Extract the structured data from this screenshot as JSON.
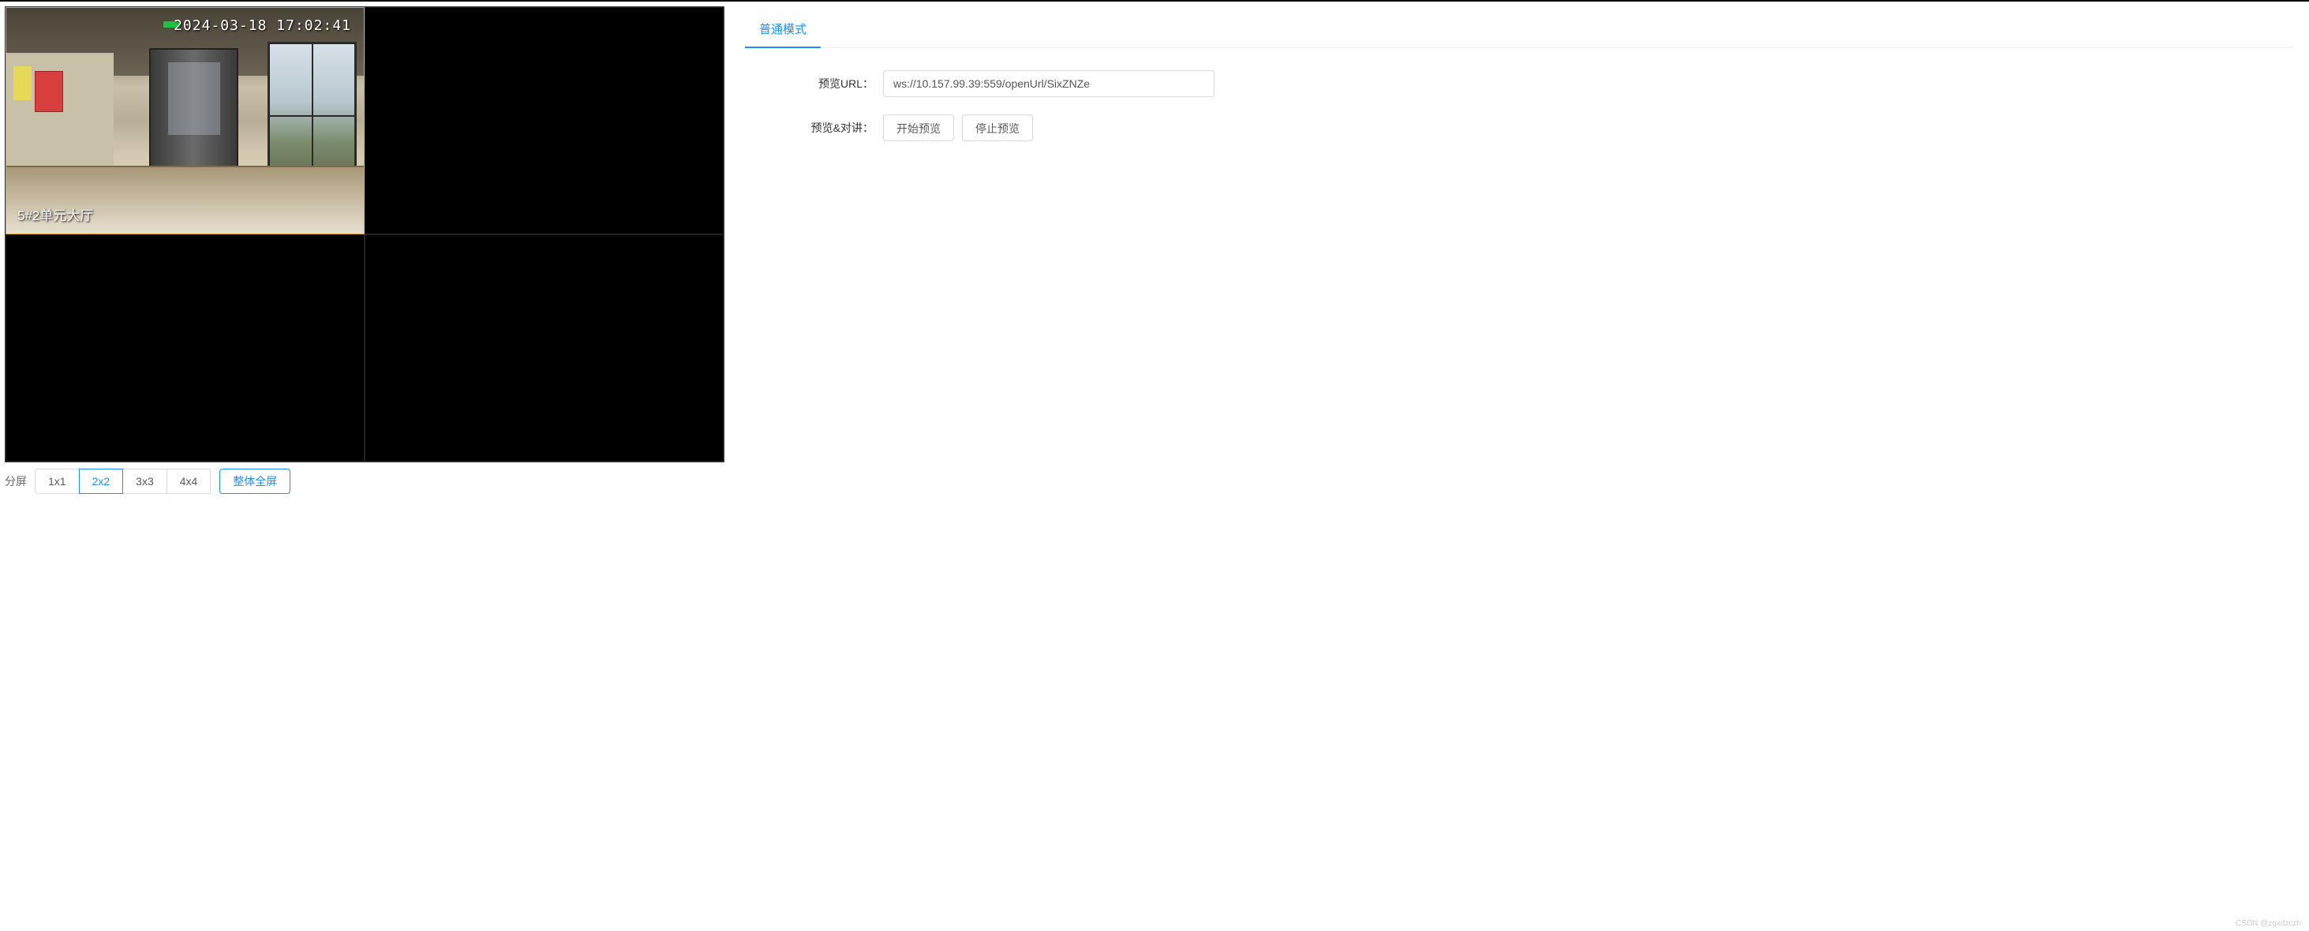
{
  "video": {
    "timestamp": "2024-03-18 17:02:41",
    "camera_label": "5#2单元大厅"
  },
  "footer": {
    "split_label": "分屏",
    "layouts": [
      "1x1",
      "2x2",
      "3x3",
      "4x4"
    ],
    "active_layout": "2x2",
    "fullscreen_label": "整体全屏"
  },
  "tabs": {
    "normal_mode": "普通模式"
  },
  "form": {
    "url_label": "预览URL：",
    "url_value": "ws://10.157.99.39:559/openUrl/SixZNZe",
    "preview_talk_label": "预览&对讲：",
    "start_preview": "开始预览",
    "stop_preview": "停止预览"
  },
  "watermark": "CSDN @zgxdzczh"
}
